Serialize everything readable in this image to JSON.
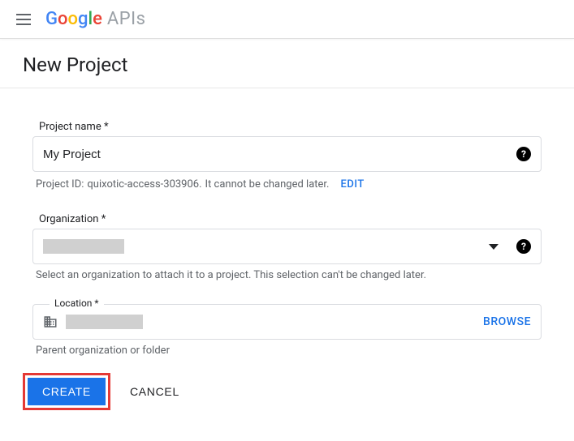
{
  "topbar": {
    "product": "APIs"
  },
  "header": {
    "title": "New Project"
  },
  "projectName": {
    "label": "Project name *",
    "value": "My Project"
  },
  "projectId": {
    "prefix": "Project ID:",
    "id": "quixotic-access-303906.",
    "notice": "It cannot be changed later.",
    "editLabel": "EDIT"
  },
  "organization": {
    "label": "Organization *",
    "helper": "Select an organization to attach it to a project. This selection can't be changed later."
  },
  "location": {
    "label": "Location *",
    "browse": "BROWSE",
    "helper": "Parent organization or folder"
  },
  "actions": {
    "create": "CREATE",
    "cancel": "CANCEL"
  }
}
